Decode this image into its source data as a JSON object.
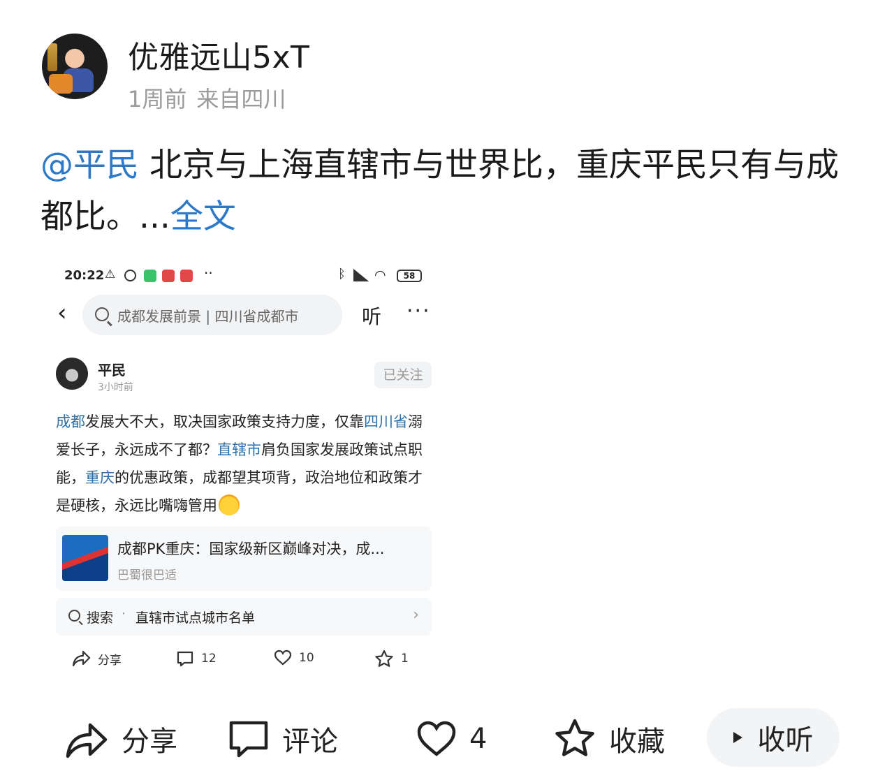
{
  "header": {
    "username": "优雅远山5xT",
    "time": "1周前",
    "location": "来自四川"
  },
  "post": {
    "mention": "@平民",
    "text": " 北京与上海直辖市与世界比，重庆平民只有与成都比。...",
    "full_text_link": "全文"
  },
  "embedded": {
    "status_bar": {
      "time": "20:22",
      "battery": "58"
    },
    "search_placeholder": "成都发展前景 | 四川省成都市",
    "listen_label": "听",
    "more_label": "···",
    "author": {
      "name": "平民",
      "time": "3小时前",
      "follow_label": "已关注"
    },
    "text_segments": [
      {
        "t": "成都",
        "link": true
      },
      {
        "t": "发展大不大，取决国家政策支持力度，仅靠",
        "link": false
      },
      {
        "t": "四川省",
        "link": true
      },
      {
        "t": "溺爱长子，永远成不了都？",
        "link": false
      },
      {
        "t": "直辖市",
        "link": true
      },
      {
        "t": "肩负国家发展政策试点职能，",
        "link": false
      },
      {
        "t": "重庆",
        "link": true
      },
      {
        "t": "的优惠政策，成都望其项背，政治地位和政策才是硬核，永远比嘴嗨管用",
        "link": false
      }
    ],
    "card": {
      "title": "成都PK重庆：国家级新区巅峰对决，成...",
      "source": "巴蜀很巴适"
    },
    "search_row": {
      "label": "搜索",
      "separator": "·",
      "query": "直辖市试点城市名单"
    },
    "actions": {
      "share": "分享",
      "comments": "12",
      "likes": "10",
      "favorites": "1"
    }
  },
  "bottom_bar": {
    "share": "分享",
    "comment": "评论",
    "likes": "4",
    "favorite": "收藏",
    "listen": "收听"
  },
  "icons": {
    "share": "share-icon",
    "comment": "comment-icon",
    "like": "heart-icon",
    "favorite": "star-icon",
    "listen": "play-icon"
  },
  "colors": {
    "link": "#2c78c9",
    "meta": "#9b9b9b",
    "text": "#1a1a1a"
  }
}
